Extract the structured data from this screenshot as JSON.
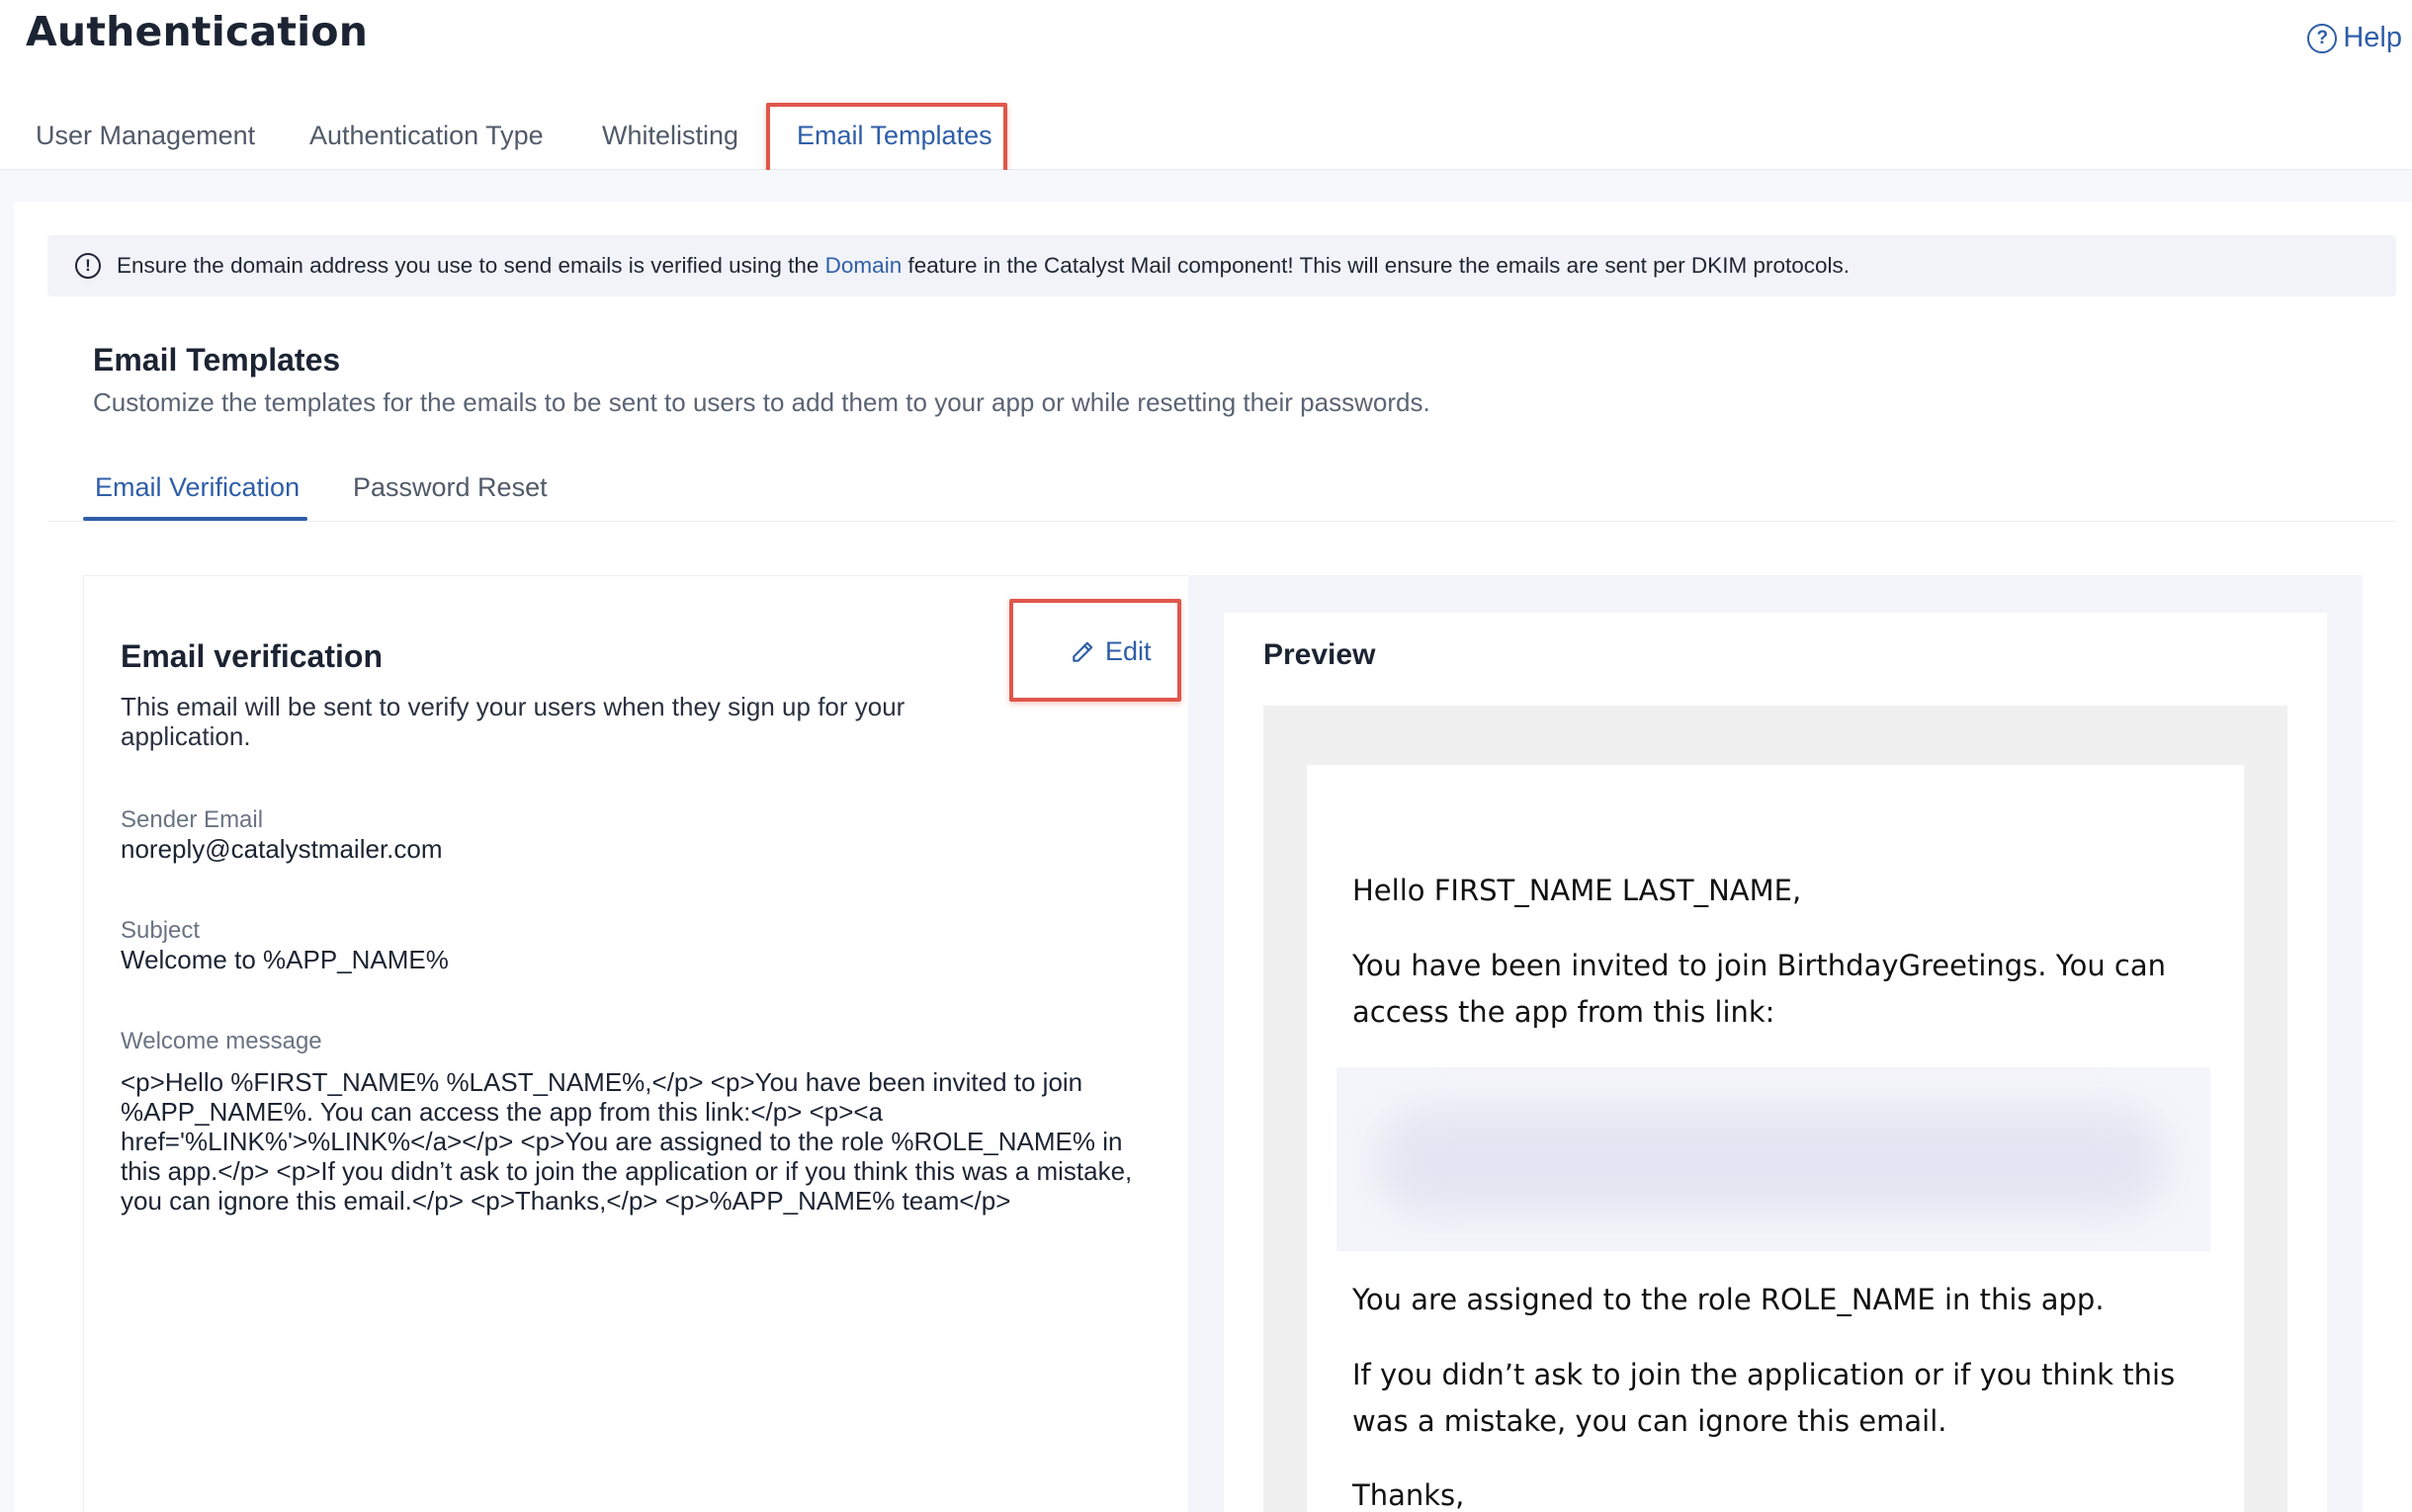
{
  "header": {
    "title": "Authentication",
    "help_label": "Help"
  },
  "top_tabs": [
    {
      "label": "User Management",
      "active": false
    },
    {
      "label": "Authentication Type",
      "active": false
    },
    {
      "label": "Whitelisting",
      "active": false
    },
    {
      "label": "Email Templates",
      "active": true
    }
  ],
  "notice": {
    "text_before": "Ensure the domain address you use to send emails is verified using the",
    "link": "Domain",
    "text_after": "feature in the Catalyst Mail component! This will ensure the emails are sent per DKIM protocols."
  },
  "section": {
    "title": "Email Templates",
    "description": "Customize the templates for the emails to be sent to users to add them to your app or while resetting their passwords."
  },
  "sub_tabs": [
    {
      "label": "Email Verification",
      "active": true
    },
    {
      "label": "Password Reset",
      "active": false
    }
  ],
  "template": {
    "title": "Email verification",
    "description": "This email will be sent to verify your users when they sign up for your application.",
    "edit_label": "Edit",
    "sender_label": "Sender Email",
    "sender_value": "noreply@catalystmailer.com",
    "subject_label": "Subject",
    "subject_value": "Welcome to %APP_NAME%",
    "message_label": "Welcome message",
    "message_value": "<p>Hello %FIRST_NAME% %LAST_NAME%,</p> <p>You have been invited to join %APP_NAME%. You can access the app from this link:</p> <p><a href='%LINK%'>%LINK%</a></p> <p>You are assigned to the role %ROLE_NAME% in this app.</p> <p>If you didn’t ask to join the application or if you think this was a mistake, you can ignore this email.</p> <p>Thanks,</p> <p>%APP_NAME% team</p>"
  },
  "preview": {
    "heading": "Preview",
    "greeting": "Hello FIRST_NAME LAST_NAME,",
    "invite": "You have been invited to join BirthdayGreetings. You can access the app from this link:",
    "role": "You are assigned to the role ROLE_NAME in this app.",
    "ignore": "If you didn’t ask to join the application or if you think this was a mistake, you can ignore this email.",
    "thanks": "Thanks,"
  },
  "colors": {
    "accent": "#2f5ea8",
    "highlight": "#e0564b"
  }
}
